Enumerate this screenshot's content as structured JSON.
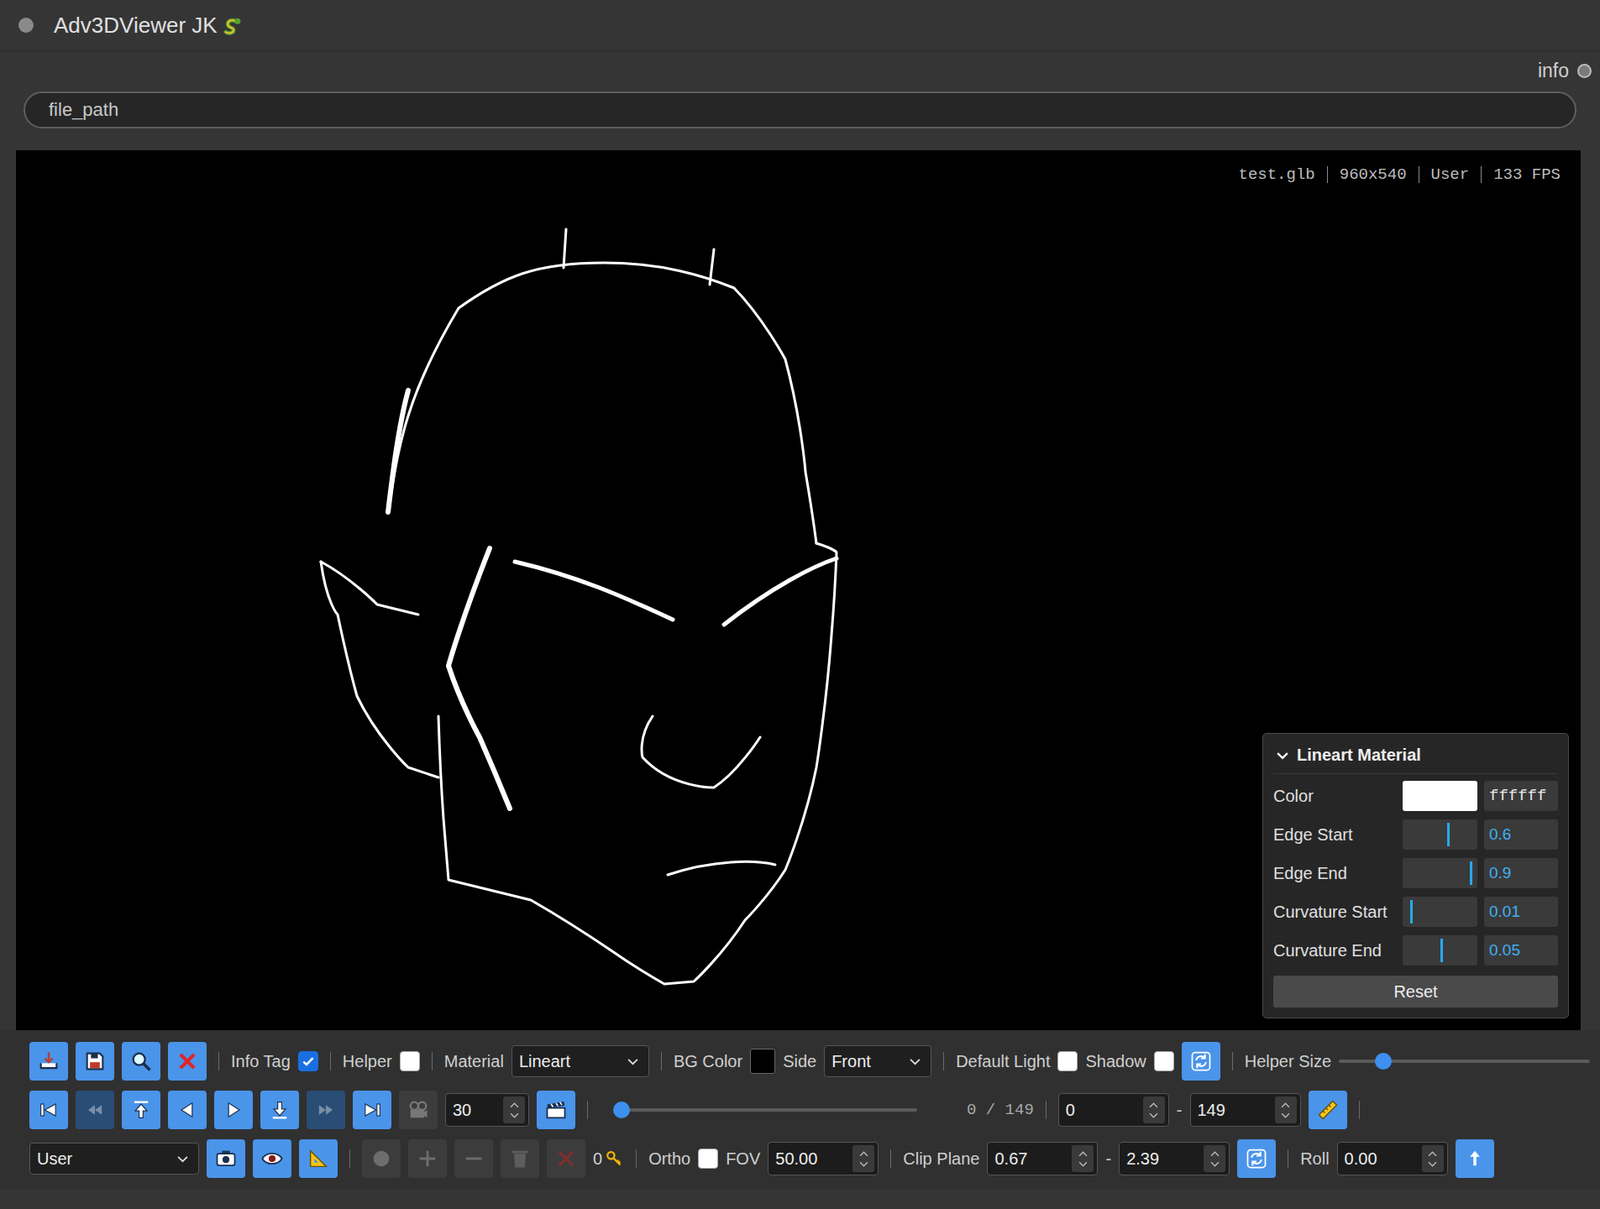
{
  "window": {
    "title": "Adv3DViewer JK",
    "output": "info"
  },
  "file_path": {
    "placeholder": "file_path"
  },
  "viewport": {
    "overlay": [
      "test.glb",
      "960x540",
      "User",
      "133 FPS"
    ]
  },
  "material_panel": {
    "title": "Lineart Material",
    "expanded": true,
    "color": {
      "label": "Color",
      "value": "ffffff",
      "color": "#ffffff"
    },
    "sliders": [
      {
        "label": "Edge Start",
        "value": "0.6",
        "level": 0.6
      },
      {
        "label": "Edge End",
        "value": "0.9",
        "level": 0.9
      },
      {
        "label": "Curvature Start",
        "value": "0.01",
        "level": 0.1
      },
      {
        "label": "Curvature End",
        "value": "0.05",
        "level": 0.5
      }
    ],
    "reset": "Reset"
  },
  "toolbar": {
    "row1": {
      "file_buttons": [
        {
          "disabled": false
        },
        {
          "disabled": false
        },
        {
          "disabled": false
        },
        {
          "disabled": false
        }
      ],
      "info_tag": {
        "label": "Info Tag",
        "checked": true
      },
      "helper": {
        "label": "Helper",
        "checked": false
      },
      "material": {
        "label": "Material",
        "value": "Lineart"
      },
      "bg_color": {
        "label": "BG Color",
        "color": "#000000"
      },
      "side": {
        "label": "Side",
        "value": "Front"
      },
      "default_light": {
        "label": "Default Light",
        "checked": false
      },
      "shadow": {
        "label": "Shadow",
        "checked": false
      },
      "light_refresh": {
        "disabled": false
      },
      "helper_size": {
        "label": "Helper Size",
        "level": 0.15
      }
    },
    "row2": {
      "transport_buttons": [
        {
          "disabled": false
        },
        {
          "disabled": true
        },
        {
          "disabled": false
        },
        {
          "disabled": false
        },
        {
          "disabled": false
        },
        {
          "disabled": false
        },
        {
          "disabled": true
        },
        {
          "disabled": false
        },
        {
          "disabled": true
        }
      ],
      "frame_step": "30",
      "render_button": {
        "disabled": false
      },
      "timeline": {
        "level": 0,
        "reading": "0 / 149"
      },
      "range": {
        "start": "0",
        "separator": "-",
        "end": "149"
      },
      "measure_button": {
        "disabled": false
      }
    },
    "row3": {
      "camera": {
        "value": "User"
      },
      "view_buttons": [
        {
          "disabled": false
        },
        {
          "disabled": false
        },
        {
          "disabled": false
        }
      ],
      "keyframe_buttons": [
        {
          "disabled": true
        },
        {
          "disabled": true
        },
        {
          "disabled": true
        },
        {
          "disabled": true
        },
        {
          "disabled": true
        }
      ],
      "key_count": "0",
      "ortho": {
        "label": "Ortho",
        "checked": false
      },
      "fov": {
        "label": "FOV",
        "value": "50.00"
      },
      "clip": {
        "label": "Clip Plane",
        "near": "0.67",
        "separator": "-",
        "far": "2.39"
      },
      "clip_refresh": {
        "disabled": false
      },
      "roll": {
        "label": "Roll",
        "value": "0.00"
      },
      "up_button": {
        "disabled": false
      }
    }
  }
}
